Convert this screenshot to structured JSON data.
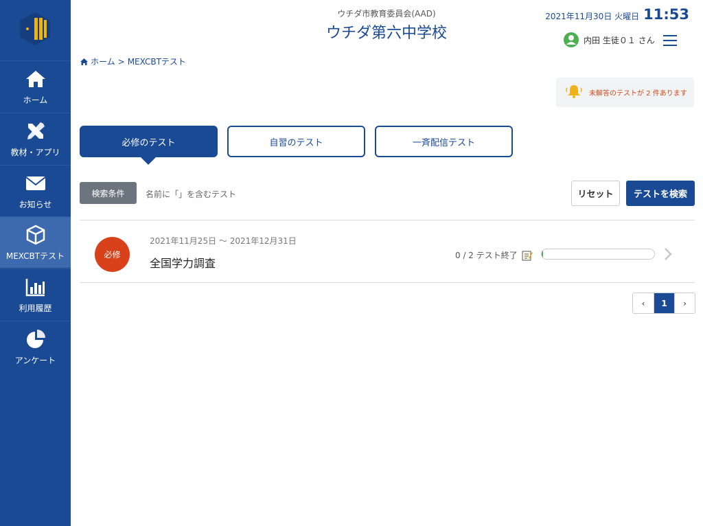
{
  "header": {
    "org": "ウチダ市教育委員会(AAD)",
    "school": "ウチダ第六中学校",
    "date": "2021年11月30日 火曜日",
    "time": "11:53",
    "user": "内田 生徒０１ さん"
  },
  "sidebar": {
    "items": [
      {
        "label": "ホーム",
        "icon": "home-icon"
      },
      {
        "label": "教材・アプリ",
        "icon": "tools-icon"
      },
      {
        "label": "お知らせ",
        "icon": "mail-icon"
      },
      {
        "label": "MEXCBTテスト",
        "icon": "cube-icon"
      },
      {
        "label": "利用履歴",
        "icon": "bar-chart-icon"
      },
      {
        "label": "アンケート",
        "icon": "pie-chart-icon"
      }
    ]
  },
  "breadcrumb": {
    "home": "ホーム",
    "separator": ">",
    "current": "MEXCBTテスト"
  },
  "notice": {
    "text": "未解答のテストが 2 件あります"
  },
  "tabs": [
    {
      "label": "必修のテスト"
    },
    {
      "label": "自習のテスト"
    },
    {
      "label": "一斉配信テスト"
    }
  ],
  "search": {
    "label": "検索条件",
    "condition": "名前に「」を含むテスト",
    "reset": "リセット",
    "submit": "テストを検索"
  },
  "tests": [
    {
      "badge": "必修",
      "period": "2021年11月25日 ～ 2021年12月31日",
      "title": "全国学力調査",
      "progress_text": "0 / 2 テスト終了",
      "completed": 0,
      "total": 2
    }
  ],
  "pagination": {
    "prev": "‹",
    "current": "1",
    "next": "›"
  },
  "colors": {
    "primary": "#1a4a94",
    "required": "#d8411a",
    "notice": "#d04a1d",
    "progress": "#4caf50"
  }
}
